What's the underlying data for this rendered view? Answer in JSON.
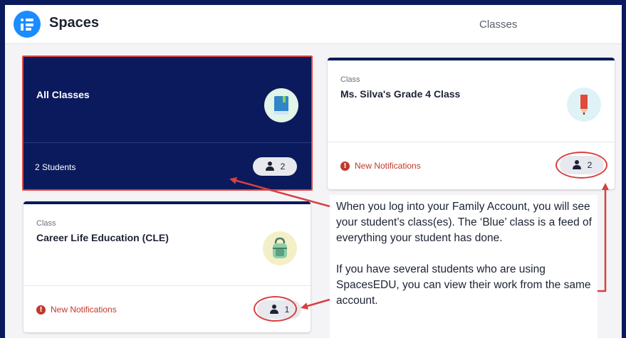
{
  "header": {
    "app_title": "Spaces",
    "active_tab": "Classes"
  },
  "cards": {
    "all_classes": {
      "title": "All Classes",
      "students_label": "2 Students",
      "student_count": "2",
      "icon": "book-icon"
    },
    "silva": {
      "kind": "Class",
      "title": "Ms. Silva's Grade 4 Class",
      "notification": "New Notifications",
      "student_count": "2",
      "icon": "pencil-icon"
    },
    "cle": {
      "kind": "Class",
      "title": "Career Life Education (CLE)",
      "notification": "New Notifications",
      "student_count": "1",
      "icon": "backpack-icon"
    }
  },
  "callout": {
    "paragraph_1": "When you log into your Family Account, you will see your student’s class(es). The ‘Blue’ class is a feed of everything your student has done.",
    "paragraph_2": "If you have several students who are using SpacesEDU, you can view their work from the same account."
  },
  "colors": {
    "brand_navy": "#0a1a5c",
    "accent_blue": "#1a8cff",
    "annotation_red": "#d94040",
    "notification_red": "#c0392b"
  }
}
